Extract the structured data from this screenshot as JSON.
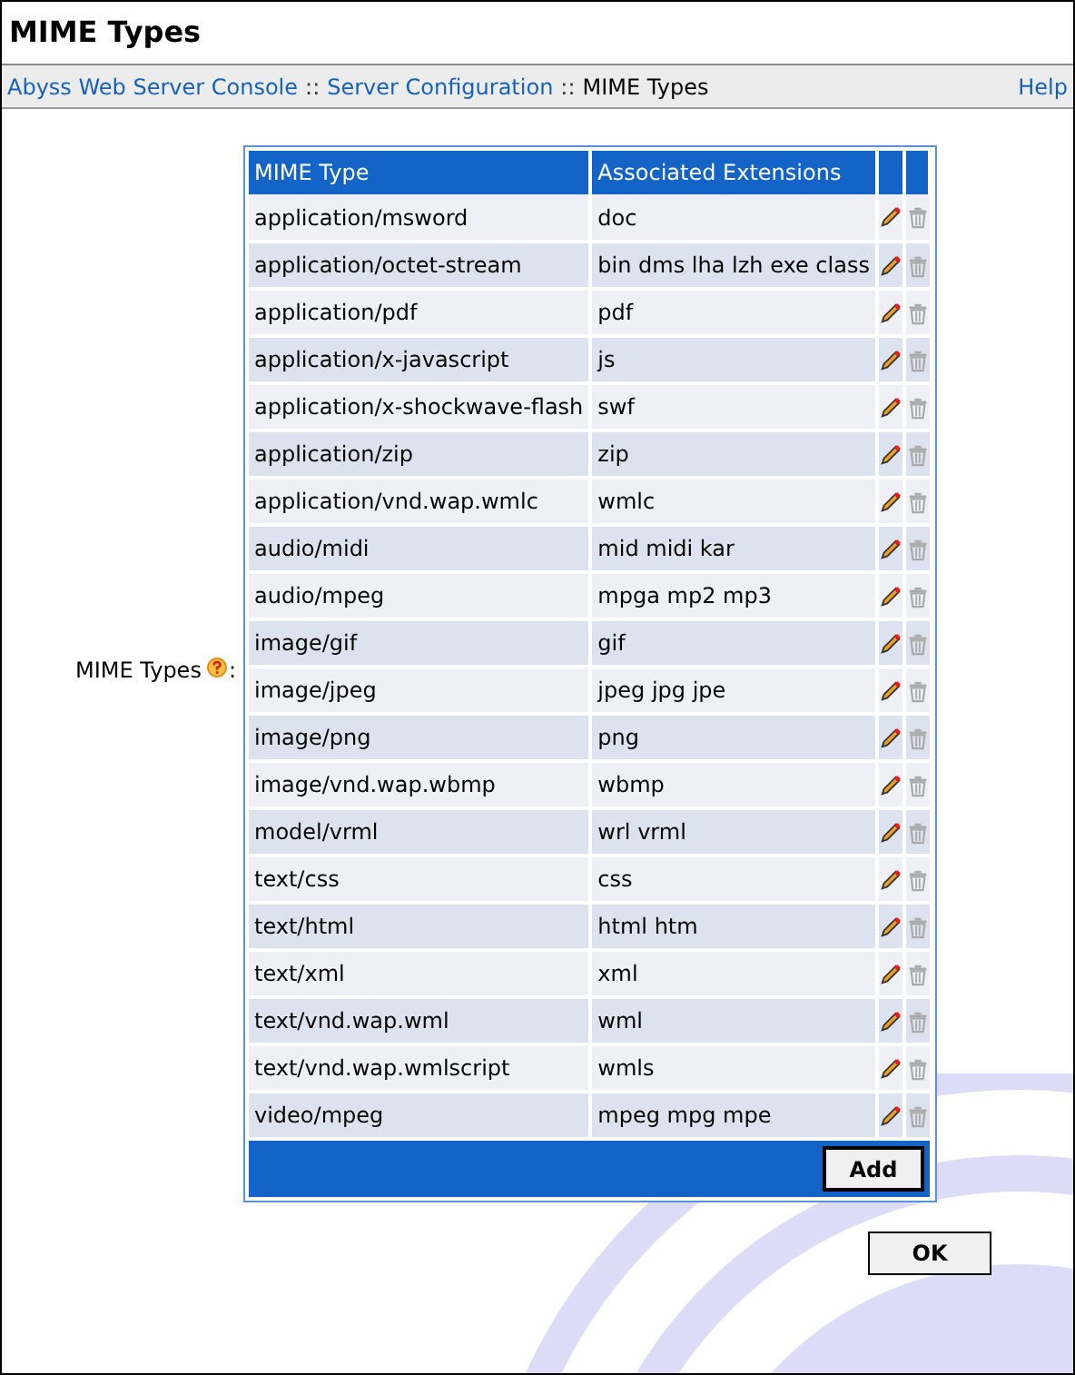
{
  "page_title": "MIME Types",
  "breadcrumb": {
    "links": [
      "Abyss Web Server Console",
      "Server Configuration"
    ],
    "separator": "::",
    "current": "MIME Types",
    "help": "Help"
  },
  "field_label": "MIME Types",
  "field_suffix": ":",
  "table": {
    "columns": [
      "MIME Type",
      "Associated Extensions"
    ],
    "rows": [
      {
        "type": "application/msword",
        "extensions": "doc"
      },
      {
        "type": "application/octet-stream",
        "extensions": "bin dms lha lzh exe class"
      },
      {
        "type": "application/pdf",
        "extensions": "pdf"
      },
      {
        "type": "application/x-javascript",
        "extensions": "js"
      },
      {
        "type": "application/x-shockwave-flash",
        "extensions": "swf"
      },
      {
        "type": "application/zip",
        "extensions": "zip"
      },
      {
        "type": "application/vnd.wap.wmlc",
        "extensions": "wmlc"
      },
      {
        "type": "audio/midi",
        "extensions": "mid midi kar"
      },
      {
        "type": "audio/mpeg",
        "extensions": "mpga mp2 mp3"
      },
      {
        "type": "image/gif",
        "extensions": "gif"
      },
      {
        "type": "image/jpeg",
        "extensions": "jpeg jpg jpe"
      },
      {
        "type": "image/png",
        "extensions": "png"
      },
      {
        "type": "image/vnd.wap.wbmp",
        "extensions": "wbmp"
      },
      {
        "type": "model/vrml",
        "extensions": "wrl vrml"
      },
      {
        "type": "text/css",
        "extensions": "css"
      },
      {
        "type": "text/html",
        "extensions": "html htm"
      },
      {
        "type": "text/xml",
        "extensions": "xml"
      },
      {
        "type": "text/vnd.wap.wml",
        "extensions": "wml"
      },
      {
        "type": "text/vnd.wap.wmlscript",
        "extensions": "wmls"
      },
      {
        "type": "video/mpeg",
        "extensions": "mpeg mpg mpe"
      }
    ],
    "add_button": "Add"
  },
  "ok_button": "OK"
}
